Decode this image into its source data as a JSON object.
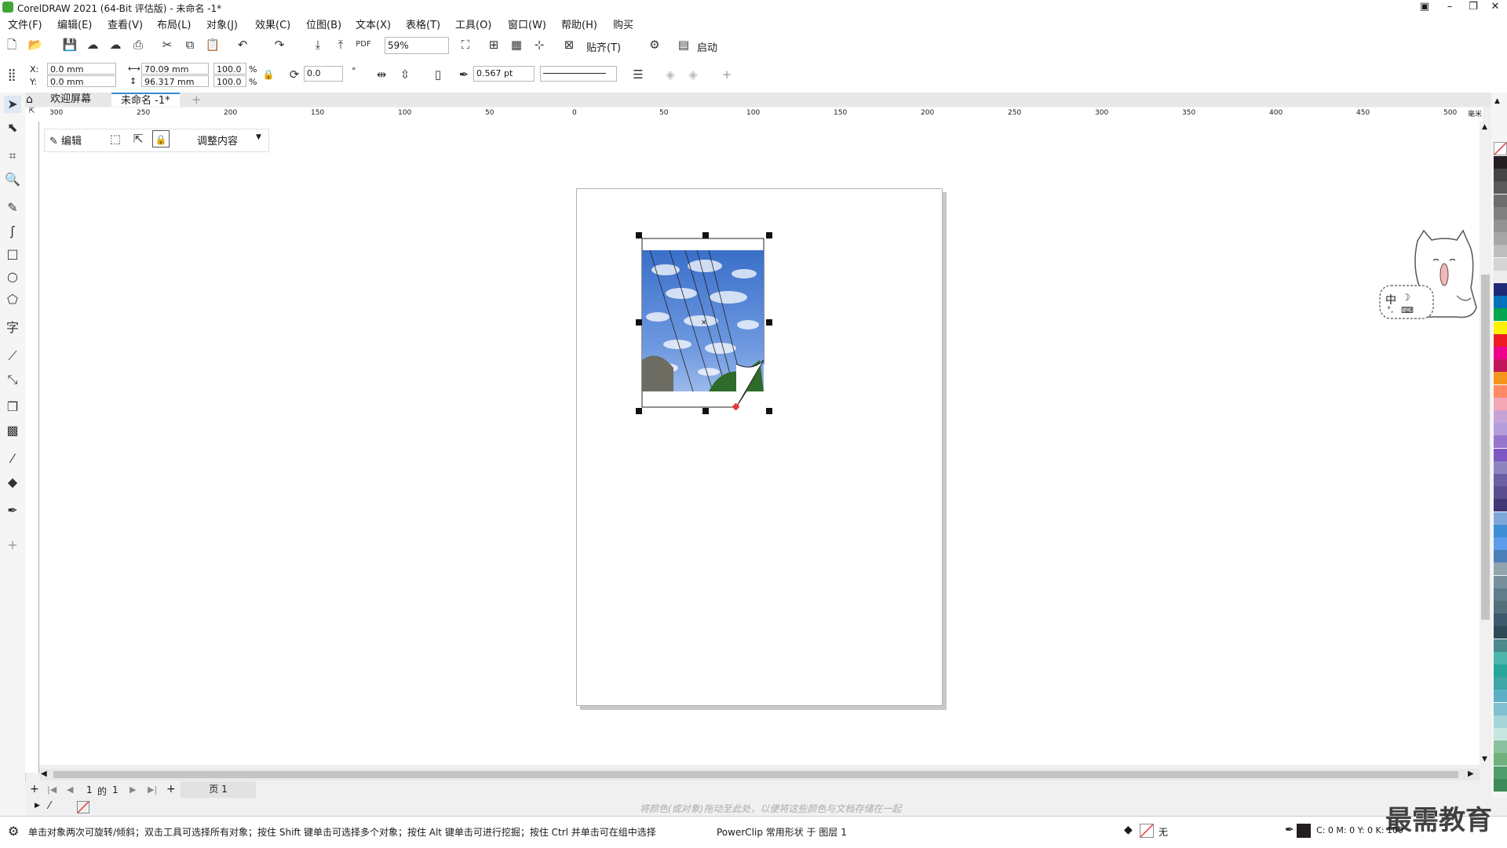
{
  "title": "CorelDRAW 2021 (64-Bit 评估版) - 未命名 -1*",
  "menu": [
    "文件(F)",
    "编辑(E)",
    "查看(V)",
    "布局(L)",
    "对象(J)",
    "效果(C)",
    "位图(B)",
    "文本(X)",
    "表格(T)",
    "工具(O)",
    "窗口(W)",
    "帮助(H)",
    "购买"
  ],
  "toolbar1": {
    "zoom": "59%",
    "snap_label": "贴齐(T)",
    "launch_label": "启动"
  },
  "props": {
    "x_label": "X:",
    "y_label": "Y:",
    "x": "0.0 mm",
    "y": "0.0 mm",
    "width": "70.09 mm",
    "height": "96.317 mm",
    "scale_w": "100.0",
    "scale_h": "100.0",
    "pct": "%",
    "rotation": "0.0",
    "degree": "°",
    "outline_width": "0.567 pt"
  },
  "tabs": {
    "welcome": "欢迎屏幕",
    "doc": "未命名 -1*"
  },
  "ruler_labels": [
    "300",
    "250",
    "200",
    "150",
    "100",
    "50",
    "0",
    "50",
    "100",
    "150",
    "200",
    "250",
    "300",
    "350",
    "400",
    "450",
    "500"
  ],
  "ruler_unit": "毫米",
  "powerclip_bar": {
    "edit": "编辑",
    "adjust": "调整内容"
  },
  "page_nav": {
    "current": "1",
    "of": "的",
    "total": "1",
    "page_tab": "页 1"
  },
  "color_hint": "将颜色(或对象)拖动至此处，以便将这些颜色与文档存储在一起",
  "status": {
    "hint": "单击对象两次可旋转/倾斜；双击工具可选择所有对象；按住 Shift 键单击可选择多个对象；按住 Alt 键单击可进行挖掘；按住 Ctrl 并单击可在组中选择",
    "object": "PowerClip 常用形状 于 图层 1",
    "fill": "无",
    "outline": "C: 0 M: 0 Y: 0 K: 100"
  },
  "watermark": "最需教育",
  "ime": {
    "mode": "中",
    "moon": "☽"
  },
  "palette_colors": [
    "#231f20",
    "#444",
    "#5a5a5a",
    "#6d6d6d",
    "#808080",
    "#939393",
    "#a6a6a6",
    "#bdbdbd",
    "#d4d4d4",
    "#ececec",
    "#1e2a78",
    "#0072bc",
    "#00a651",
    "#fff200",
    "#ed1c24",
    "#ec008c",
    "#c2185b",
    "#f7941d",
    "#ff8a65",
    "#f4a6b7",
    "#c7a3d6",
    "#b39ddb",
    "#9575cd",
    "#7e57c2",
    "#8e84c0",
    "#6c5fa5",
    "#5b4e8e",
    "#3f3874",
    "#7da7d9",
    "#3f8ed6",
    "#5d9cec",
    "#4c7fb8",
    "#90a4ae",
    "#78909c",
    "#607d8b",
    "#546e7a",
    "#3c5a6b",
    "#2e4a56",
    "#4a8a8a",
    "#4db6ac",
    "#26a69a",
    "#3fa5a5",
    "#5cb0c6",
    "#7fbfcf",
    "#a5d6d8",
    "#c7e6e0",
    "#89c29e",
    "#6fb27e",
    "#4f9d6a",
    "#3b8a58"
  ]
}
